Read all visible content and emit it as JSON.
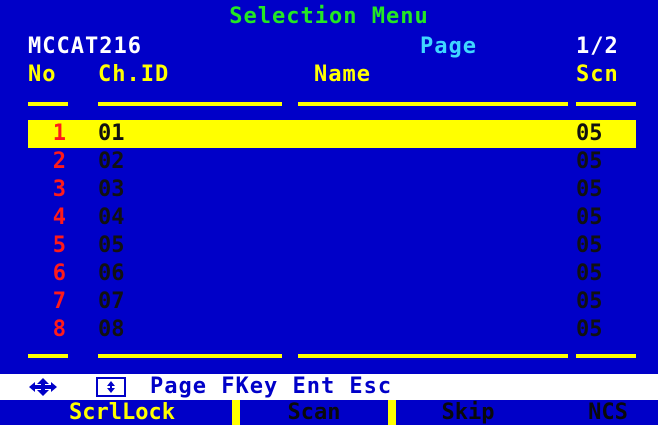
{
  "header": {
    "title": "Selection Menu",
    "model": "MCCAT216",
    "page_label": "Page",
    "page_num": "1/2"
  },
  "columns": {
    "no": "No",
    "ch_id": "Ch.ID",
    "name": "Name",
    "scn": "Scn"
  },
  "rows": [
    {
      "no": "1",
      "ch_id": "01",
      "name": "",
      "scn": "05",
      "selected": true
    },
    {
      "no": "2",
      "ch_id": "02",
      "name": "",
      "scn": "05",
      "selected": false
    },
    {
      "no": "3",
      "ch_id": "03",
      "name": "",
      "scn": "05",
      "selected": false
    },
    {
      "no": "4",
      "ch_id": "04",
      "name": "",
      "scn": "05",
      "selected": false
    },
    {
      "no": "5",
      "ch_id": "05",
      "name": "",
      "scn": "05",
      "selected": false
    },
    {
      "no": "6",
      "ch_id": "06",
      "name": "",
      "scn": "05",
      "selected": false
    },
    {
      "no": "7",
      "ch_id": "07",
      "name": "",
      "scn": "05",
      "selected": false
    },
    {
      "no": "8",
      "ch_id": "08",
      "name": "",
      "scn": "05",
      "selected": false
    }
  ],
  "help_bar": {
    "icons": [
      "arrow-keys-icon",
      "page-key-icon"
    ],
    "keys": "Page FKey Ent Esc"
  },
  "function_bar": [
    {
      "label": "ScrlLock",
      "active": true
    },
    {
      "label": "Scan",
      "active": false
    },
    {
      "label": "Skip",
      "active": false
    },
    {
      "label": "NCS",
      "active": false
    }
  ],
  "colors": {
    "background": "#0000c8",
    "title": "#23e823",
    "header_text": "#ffff00",
    "page_label": "#3fd7ff",
    "row_number": "#ff1a1a",
    "selection": "#ffff00"
  }
}
